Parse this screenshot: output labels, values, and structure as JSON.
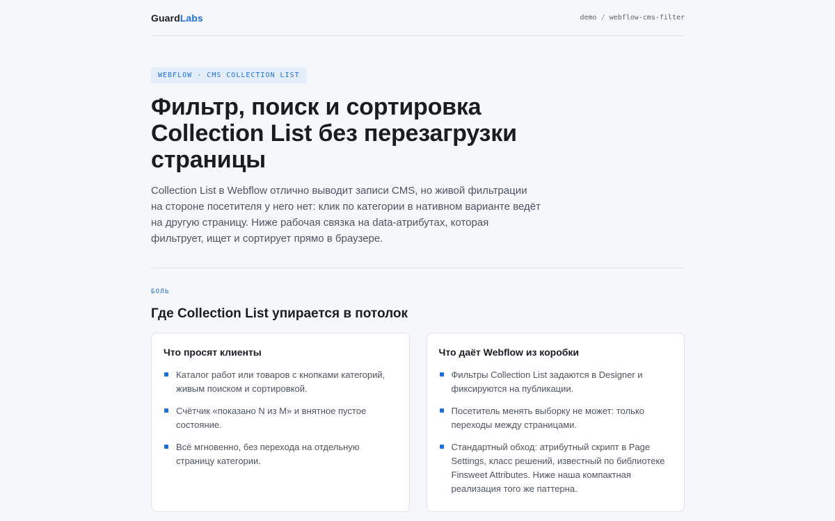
{
  "header": {
    "logo_part1": "Guard",
    "logo_part2": "Labs",
    "breadcrumb": [
      "demo",
      "webflow-cms-filter"
    ],
    "breadcrumb_separator": "/"
  },
  "hero": {
    "tag": "WEBFLOW · CMS COLLECTION LIST",
    "title": "Фильтр, поиск и сортировка Collection List без перезагрузки страницы",
    "lead": "Collection List в Webflow отлично выводит записи CMS, но живой фильтрации на стороне посетителя у него нет: клик по категории в нативном варианте ведёт на другую страницу. Ниже рабочая связка на data-атрибутах, которая фильтрует, ищет и сортирует прямо в браузере."
  },
  "section": {
    "kicker": "БОЛЬ",
    "title": "Где Collection List упирается в потолок"
  },
  "cards": [
    {
      "title": "Что просят клиенты",
      "items": [
        "Каталог работ или товаров с кнопками категорий, живым поиском и сортировкой.",
        "Счётчик «показано N из M» и внятное пустое состояние.",
        "Всё мгновенно, без перехода на отдельную страницу категории."
      ]
    },
    {
      "title": "Что даёт Webflow из коробки",
      "items": [
        "Фильтры Collection List задаются в Designer и фиксируются на публикации.",
        "Посетитель менять выборку не может: только переходы между страницами.",
        "Стандартный обход: атрибутный скрипт в Page Settings, класс решений, известный по библиотеке Finsweet Attributes. Ниже наша компактная реализация того же паттерна."
      ]
    }
  ],
  "colors": {
    "accent": "#1f6fd6",
    "background": "#f5f7fa",
    "text": "#1a1c20",
    "muted": "#4d5461"
  }
}
